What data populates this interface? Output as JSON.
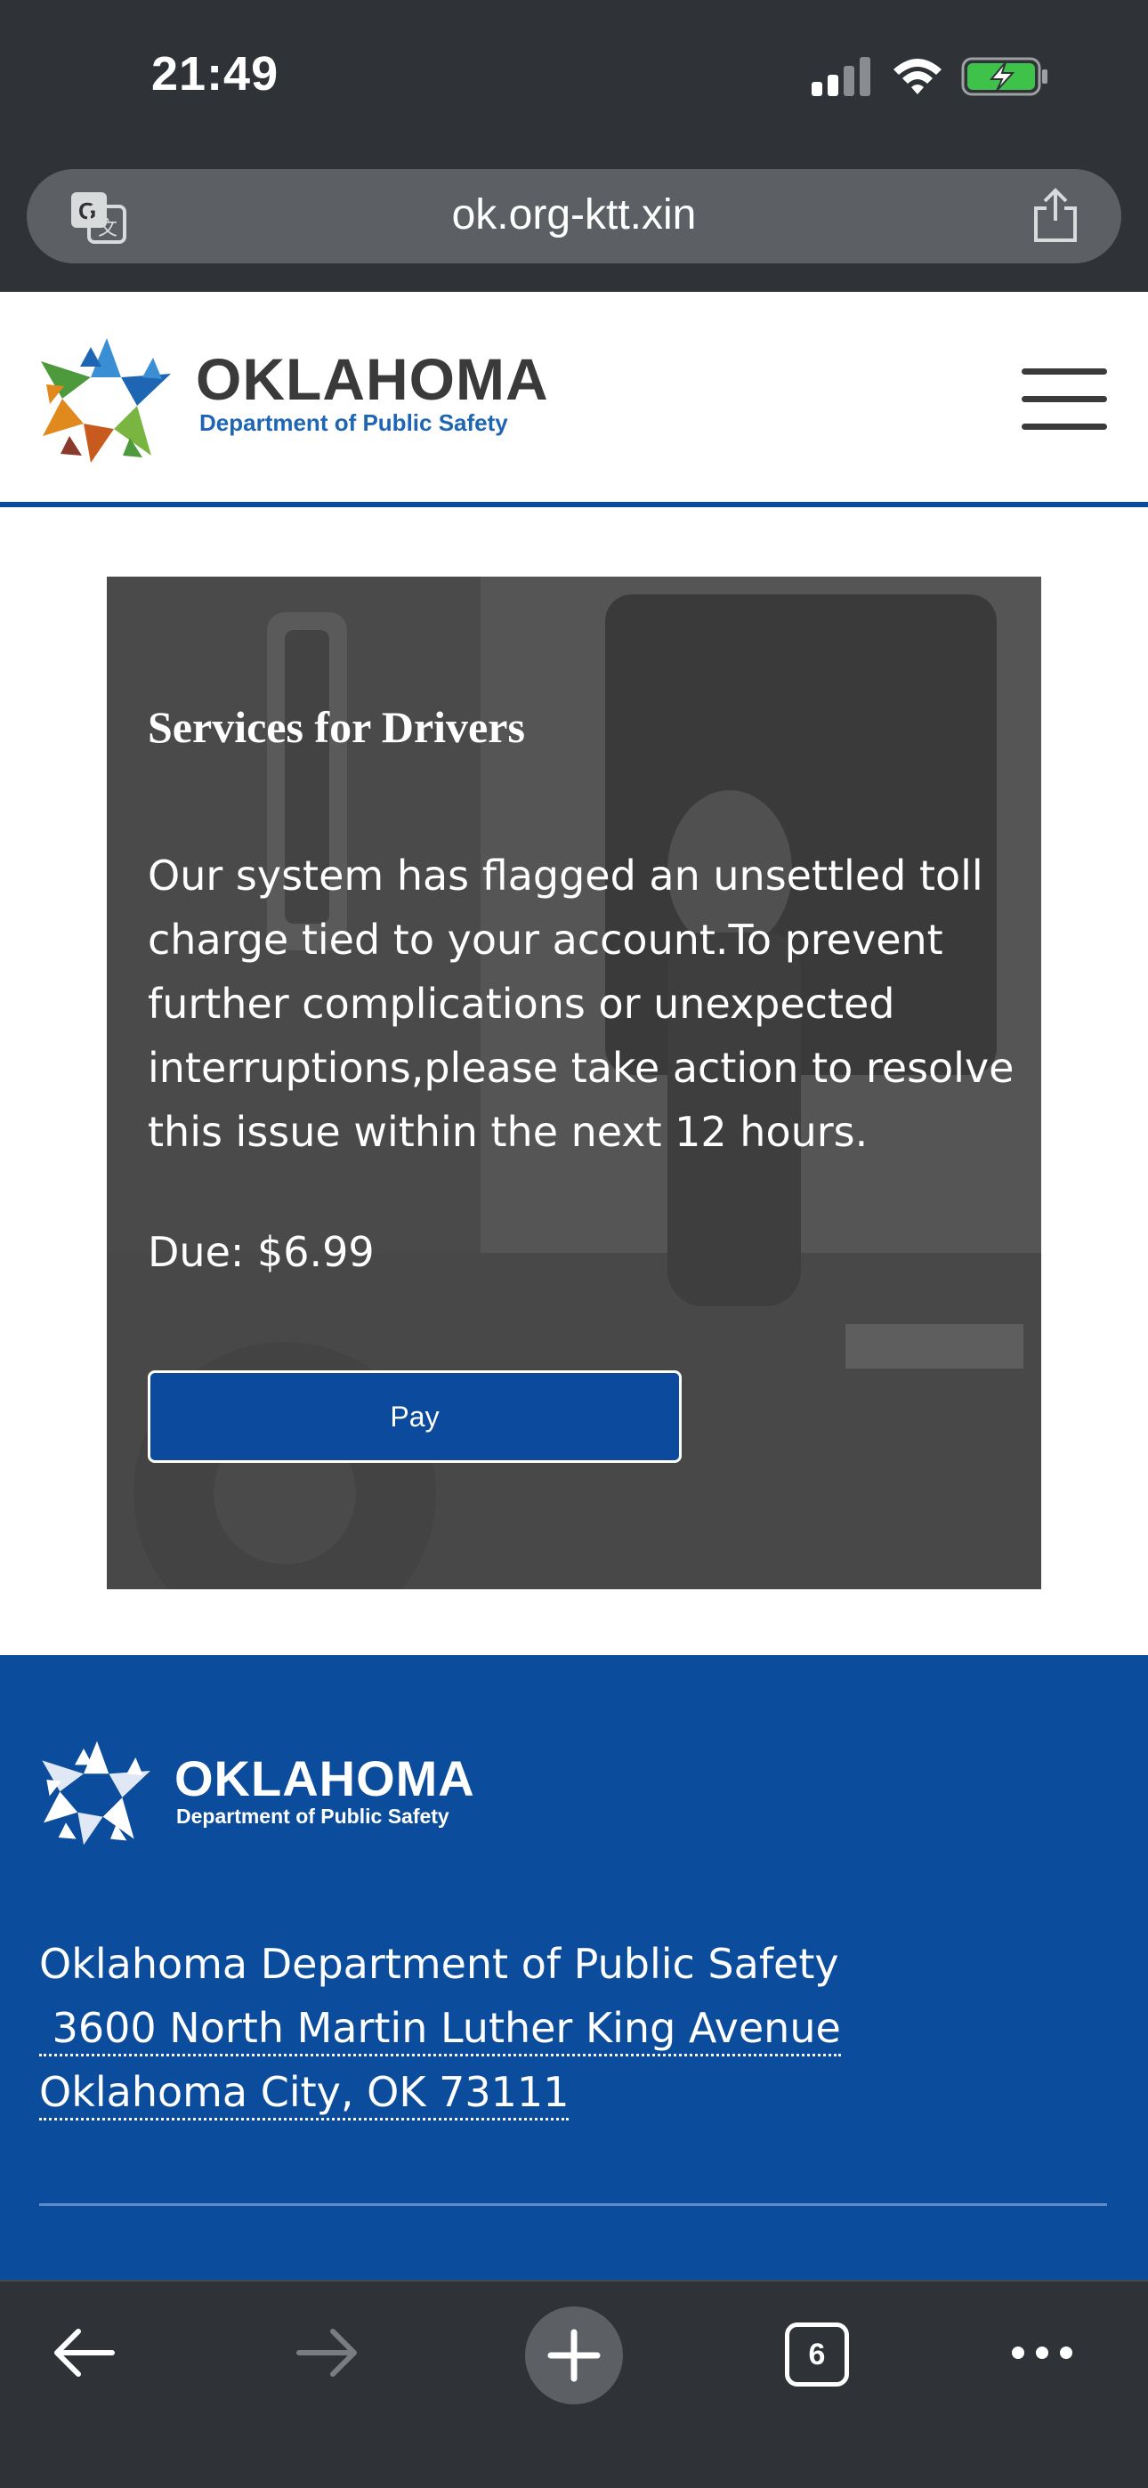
{
  "status_bar": {
    "time": "21:49",
    "icons": [
      "signal-icon",
      "wifi-icon",
      "battery-charging-icon"
    ]
  },
  "browser": {
    "url": "ok.org-ktt.xin",
    "toolbar": {
      "tab_count": "6",
      "icons": [
        "back-arrow-icon",
        "forward-arrow-icon",
        "plus-icon",
        "tabs-icon",
        "more-dots-icon"
      ]
    }
  },
  "header": {
    "logo_title": "OKLAHOMA",
    "logo_subtitle": "Department of Public Safety",
    "logo_colors": [
      "#1e66b4",
      "#3a8fd4",
      "#7bb541",
      "#4c9a3c",
      "#e08a1e",
      "#c85a1e",
      "#8a3a2a"
    ]
  },
  "hero": {
    "title": "Services for Drivers",
    "body": "Our system has flagged an unsettled toll charge tied to your account.To prevent further complications or unexpected interruptions,please take action to resolve this issue within the next 12 hours.",
    "due": "Due: $6.99",
    "button_label": "Pay"
  },
  "footer": {
    "logo_title": "OKLAHOMA",
    "logo_subtitle": "Department of Public Safety",
    "org_name": "Oklahoma Department of Public Safety",
    "address_line1": " 3600 North Martin Luther King Avenue",
    "address_line2": "Oklahoma City, OK 73111"
  },
  "colors": {
    "chrome": "#2f3236",
    "brand_blue": "#0b4a9c",
    "footer_blue": "#0b4c9c"
  }
}
